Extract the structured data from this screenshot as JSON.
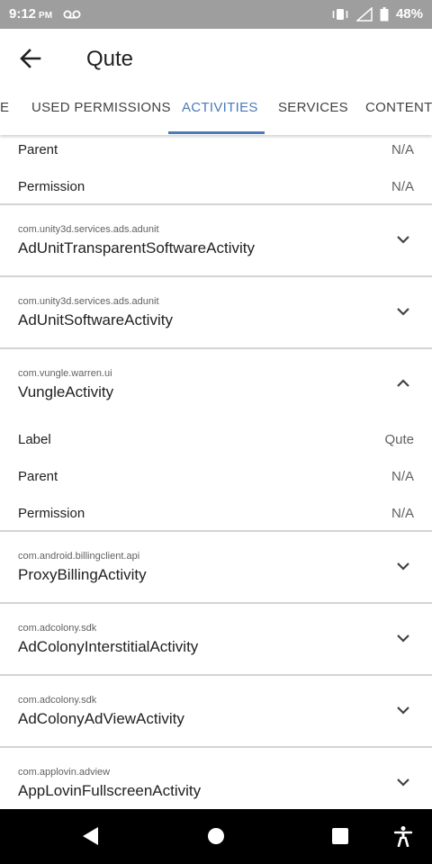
{
  "status_bar": {
    "time": "9:12",
    "ampm": "PM",
    "battery": "48%"
  },
  "app_bar": {
    "title": "Qute"
  },
  "tabs": [
    {
      "label": "E"
    },
    {
      "label": "USED PERMISSIONS"
    },
    {
      "label": "ACTIVITIES"
    },
    {
      "label": "SERVICES"
    },
    {
      "label": "CONTENT P"
    }
  ],
  "colors": {
    "accent": "#4a7ab8",
    "status_bar": "#9e9e9e"
  },
  "top_details": [
    {
      "key": "Parent",
      "value": "N/A"
    },
    {
      "key": "Permission",
      "value": "N/A"
    }
  ],
  "activities": [
    {
      "package": "com.unity3d.services.ads.adunit",
      "name": "AdUnitTransparentSoftwareActivity",
      "icon": "chevron-down-icon"
    },
    {
      "package": "com.unity3d.services.ads.adunit",
      "name": "AdUnitSoftwareActivity",
      "icon": "chevron-down-icon"
    },
    {
      "package": "com.vungle.warren.ui",
      "name": "VungleActivity",
      "icon": "chevron-up-icon",
      "details": [
        {
          "key": "Label",
          "value": "Qute"
        },
        {
          "key": "Parent",
          "value": "N/A"
        },
        {
          "key": "Permission",
          "value": "N/A"
        }
      ]
    },
    {
      "package": "com.android.billingclient.api",
      "name": "ProxyBillingActivity",
      "icon": "chevron-down-icon"
    },
    {
      "package": "com.adcolony.sdk",
      "name": "AdColonyInterstitialActivity",
      "icon": "chevron-down-icon"
    },
    {
      "package": "com.adcolony.sdk",
      "name": "AdColonyAdViewActivity",
      "icon": "chevron-down-icon"
    },
    {
      "package": "com.applovin.adview",
      "name": "AppLovinFullscreenActivity",
      "icon": "chevron-down-icon"
    }
  ],
  "nav_bar": [
    "back-icon",
    "home-icon",
    "recents-icon",
    "accessibility-icon"
  ]
}
